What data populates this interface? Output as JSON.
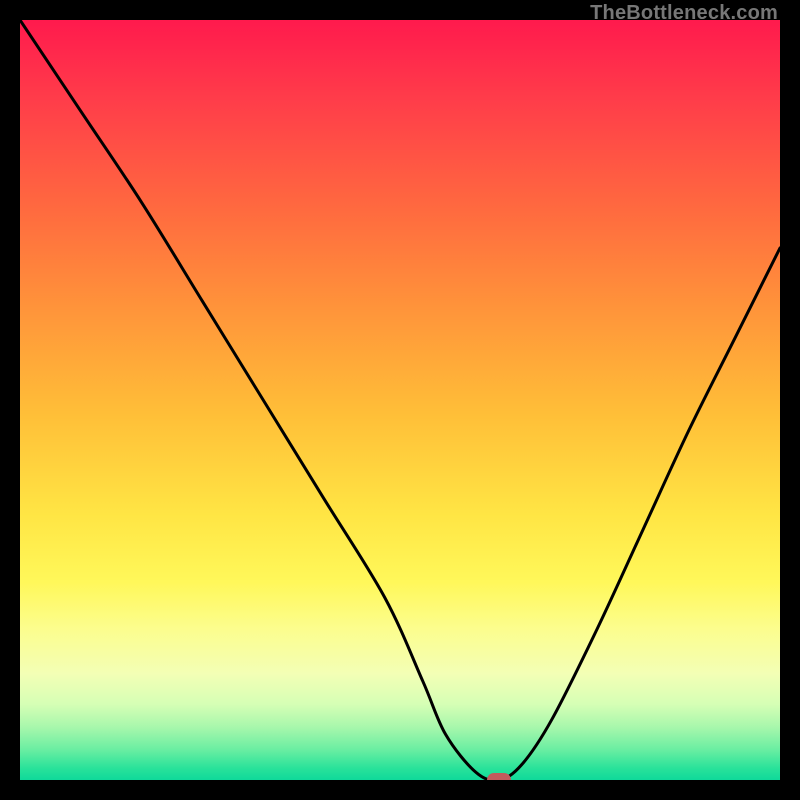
{
  "watermark": "TheBottleneck.com",
  "chart_data": {
    "type": "line",
    "title": "",
    "xlabel": "",
    "ylabel": "",
    "xlim": [
      0,
      100
    ],
    "ylim": [
      0,
      100
    ],
    "grid": false,
    "legend": false,
    "series": [
      {
        "name": "bottleneck-curve",
        "x": [
          0,
          8,
          16,
          24,
          32,
          40,
          48,
          53,
          56,
          60,
          63,
          66,
          70,
          76,
          82,
          88,
          94,
          100
        ],
        "y": [
          100,
          88,
          76,
          63,
          50,
          37,
          24,
          13,
          6,
          1,
          0,
          2,
          8,
          20,
          33,
          46,
          58,
          70
        ]
      }
    ],
    "marker": {
      "x": 63,
      "y": 0,
      "name": "optimal-point"
    },
    "gradient_stops": [
      {
        "pos": 0,
        "color": "#ff1a4d"
      },
      {
        "pos": 10,
        "color": "#ff3b4a"
      },
      {
        "pos": 25,
        "color": "#ff6a3f"
      },
      {
        "pos": 38,
        "color": "#ff943a"
      },
      {
        "pos": 52,
        "color": "#ffbf38"
      },
      {
        "pos": 65,
        "color": "#ffe544"
      },
      {
        "pos": 74,
        "color": "#fff85a"
      },
      {
        "pos": 80,
        "color": "#fcfd8d"
      },
      {
        "pos": 86,
        "color": "#f3ffb5"
      },
      {
        "pos": 90,
        "color": "#d6ffb5"
      },
      {
        "pos": 93,
        "color": "#a8f7ac"
      },
      {
        "pos": 96,
        "color": "#6aeea2"
      },
      {
        "pos": 98.5,
        "color": "#28e29a"
      },
      {
        "pos": 100,
        "color": "#0fd99a"
      }
    ]
  }
}
